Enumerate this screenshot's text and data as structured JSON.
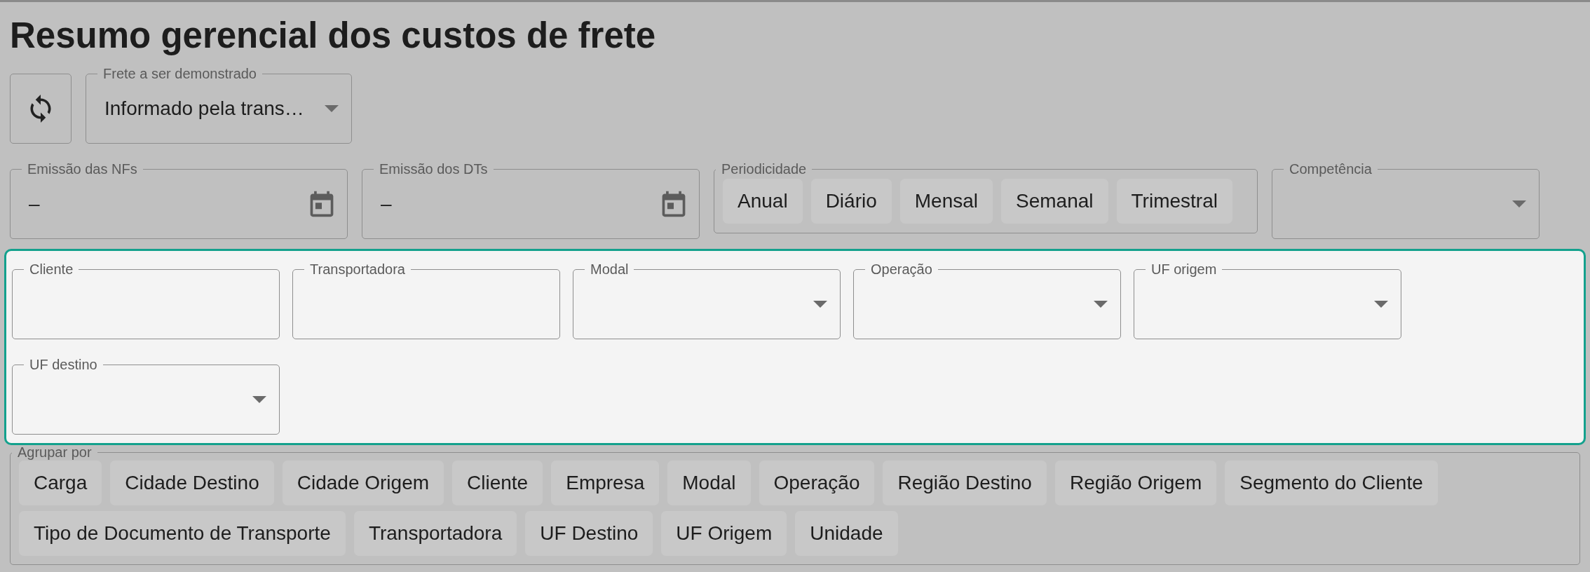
{
  "title": "Resumo gerencial dos custos de frete",
  "freight_select": {
    "label": "Frete a ser demonstrado",
    "value": "Informado pela trans…"
  },
  "date_fields": [
    {
      "label": "Emissão das NFs",
      "value": "–"
    },
    {
      "label": "Emissão dos DTs",
      "value": "–"
    }
  ],
  "periodicity": {
    "label": "Periodicidade",
    "options": [
      {
        "label": "Anual",
        "selected": false
      },
      {
        "label": "Diário",
        "selected": false
      },
      {
        "label": "Mensal",
        "selected": false
      },
      {
        "label": "Semanal",
        "selected": false
      },
      {
        "label": "Trimestral",
        "selected": false
      }
    ]
  },
  "competence": {
    "label": "Competência"
  },
  "filters": [
    {
      "label": "Cliente",
      "kind": "text"
    },
    {
      "label": "Transportadora",
      "kind": "text"
    },
    {
      "label": "Modal",
      "kind": "select"
    },
    {
      "label": "Operação",
      "kind": "select"
    },
    {
      "label": "UF origem",
      "kind": "select"
    },
    {
      "label": "UF destino",
      "kind": "select"
    }
  ],
  "group_by": {
    "label": "Agrupar por",
    "options": [
      {
        "label": "Carga",
        "selected": false
      },
      {
        "label": "Cidade Destino",
        "selected": false
      },
      {
        "label": "Cidade Origem",
        "selected": false
      },
      {
        "label": "Cliente",
        "selected": false
      },
      {
        "label": "Empresa",
        "selected": false
      },
      {
        "label": "Modal",
        "selected": false
      },
      {
        "label": "Operação",
        "selected": false
      },
      {
        "label": "Região Destino",
        "selected": false
      },
      {
        "label": "Região Origem",
        "selected": false
      },
      {
        "label": "Segmento do Cliente",
        "selected": false
      },
      {
        "label": "Tipo de Documento de Transporte",
        "selected": false
      },
      {
        "label": "Transportadora",
        "selected": false
      },
      {
        "label": "UF Destino",
        "selected": false
      },
      {
        "label": "UF Origem",
        "selected": false
      },
      {
        "label": "Unidade",
        "selected": false
      }
    ]
  }
}
